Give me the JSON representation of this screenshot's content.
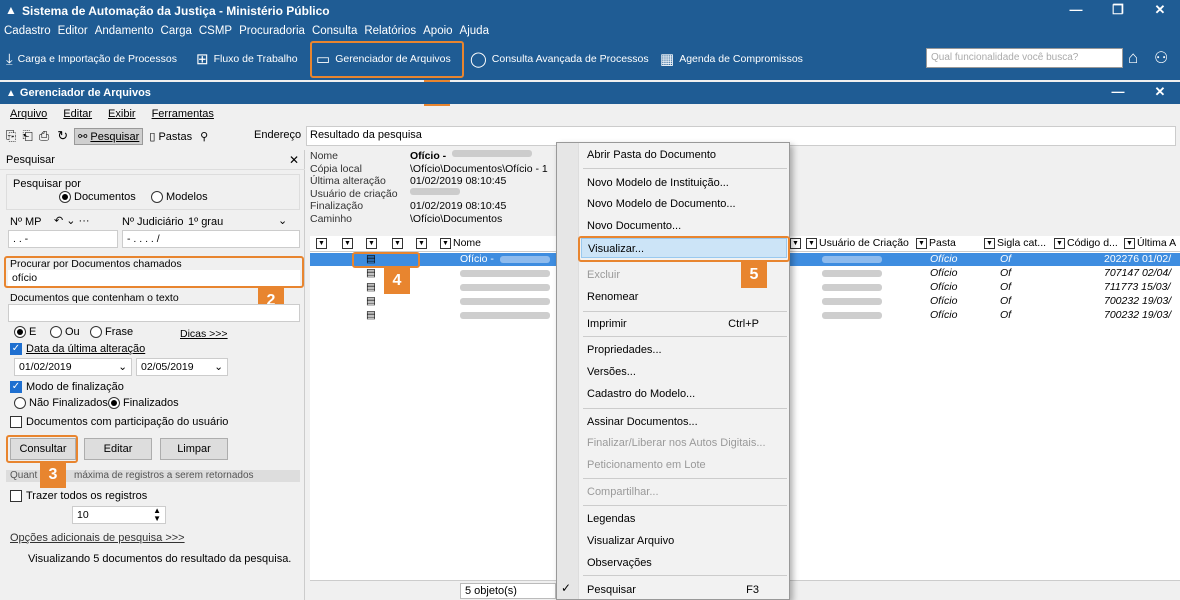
{
  "app": {
    "title": "Sistema de Automação da Justiça - Ministério Público",
    "menu": [
      "Cadastro",
      "Editor",
      "Andamento",
      "Carga",
      "CSMP",
      "Procuradoria",
      "Consulta",
      "Relatórios",
      "Apoio",
      "Ajuda"
    ],
    "toolbar": {
      "carga": "Carga e Importação de Processos",
      "fluxo": "Fluxo de Trabalho",
      "gerenciador": "Gerenciador de Arquivos",
      "consulta": "Consulta Avançada de Processos",
      "agenda": "Agenda de Compromissos"
    },
    "search_placeholder": "Qual funcionalidade você busca?"
  },
  "inner": {
    "title": "Gerenciador de Arquivos",
    "menu": [
      "Arquivo",
      "Editar",
      "Exibir",
      "Ferramentas"
    ],
    "toolbar_search": "Pesquisar",
    "toolbar_folders": "Pastas",
    "address_label": "Endereço",
    "address_value": "Resultado da pesquisa"
  },
  "left": {
    "header": "Pesquisar",
    "search_for_label": "Pesquisar por",
    "opt_documents": "Documentos",
    "opt_models": "Modelos",
    "mp_label": "Nº MP",
    "judicial_label": "Nº Judiciário",
    "grau": "1º grau",
    "mp_value": ". . -",
    "judicial_value": "- . . . . /",
    "docs_named_label": "Procurar por Documentos chamados",
    "docs_named_value": "ofício",
    "docs_text_label": "Documentos que contenham o texto",
    "docs_text_value": "",
    "opt_e": "E",
    "opt_ou": "Ou",
    "opt_frase": "Frase",
    "dicas": "Dicas >>>",
    "last_change_label": "Data da última alteração",
    "date_from": "01/02/2019",
    "date_to": "02/05/2019",
    "final_mode_label": "Modo de finalização",
    "not_finalized": "Não Finalizados",
    "finalized": "Finalizados",
    "user_participation": "Documentos com participação do usuário",
    "btn_consultar": "Consultar",
    "btn_editar": "Editar",
    "btn_limpar": "Limpar",
    "max_records_label": "Quantidade máxima de registros a serem retornados",
    "max_records_visible": "Quant",
    "max_records_rest": "máxima de registros a serem retornados",
    "bring_all": "Trazer todos os registros",
    "records_value": "10",
    "extra_options": "Opções adicionais de pesquisa >>>",
    "viewing_summary": "Visualizando 5 documentos do resultado da pesquisa."
  },
  "details": {
    "rows": [
      {
        "k": "Nome",
        "v": "Ofício -"
      },
      {
        "k": "Cópia local",
        "v": "\\Ofício\\Documentos\\Ofício - 1"
      },
      {
        "k": "Última alteração",
        "v": "01/02/2019 08:10:45"
      },
      {
        "k": "Usuário de criação",
        "v": ""
      },
      {
        "k": "Finalização",
        "v": "01/02/2019 08:10:45"
      },
      {
        "k": "Caminho",
        "v": "\\Ofício\\Documentos"
      }
    ]
  },
  "grid": {
    "col_name": "Nome",
    "col_user": "Usuário de Criação",
    "col_folder": "Pasta",
    "col_sigla": "Sigla cat...",
    "col_code": "Código d...",
    "col_last": "Última A",
    "rows": [
      {
        "name": "Ofício -",
        "folder": "Ofício",
        "sigla": "Of",
        "code": "202276 01/02/"
      },
      {
        "name": "",
        "folder": "Ofício",
        "sigla": "Of",
        "code": "707147 02/04/"
      },
      {
        "name": "",
        "folder": "Ofício",
        "sigla": "Of",
        "code": "711773 15/03/"
      },
      {
        "name": "",
        "folder": "Ofício",
        "sigla": "Of",
        "code": "700232 19/03/"
      },
      {
        "name": "",
        "folder": "Ofício",
        "sigla": "Of",
        "code": "700232 19/03/"
      }
    ],
    "status": "5 objeto(s)"
  },
  "context_menu": {
    "items": [
      "Abrir Pasta do Documento",
      "Novo Modelo de Instituição...",
      "Novo Modelo de Documento...",
      "Novo Documento...",
      "Visualizar...",
      "Excluir",
      "Renomear",
      "Imprimir",
      "Propriedades...",
      "Versões...",
      "Cadastro do Modelo...",
      "Assinar Documentos...",
      "Finalizar/Liberar nos Autos Digitais...",
      "Peticionamento em Lote",
      "Compartilhar...",
      "Legendas",
      "Visualizar Arquivo",
      "Observações",
      "Pesquisar"
    ],
    "print_shortcut": "Ctrl+P",
    "search_shortcut": "F3"
  },
  "callouts": [
    "1",
    "2",
    "3",
    "4",
    "5"
  ],
  "colors": {
    "titlebar": "#1f5c94",
    "accent": "#e8852f",
    "selection": "#3e8de0"
  }
}
